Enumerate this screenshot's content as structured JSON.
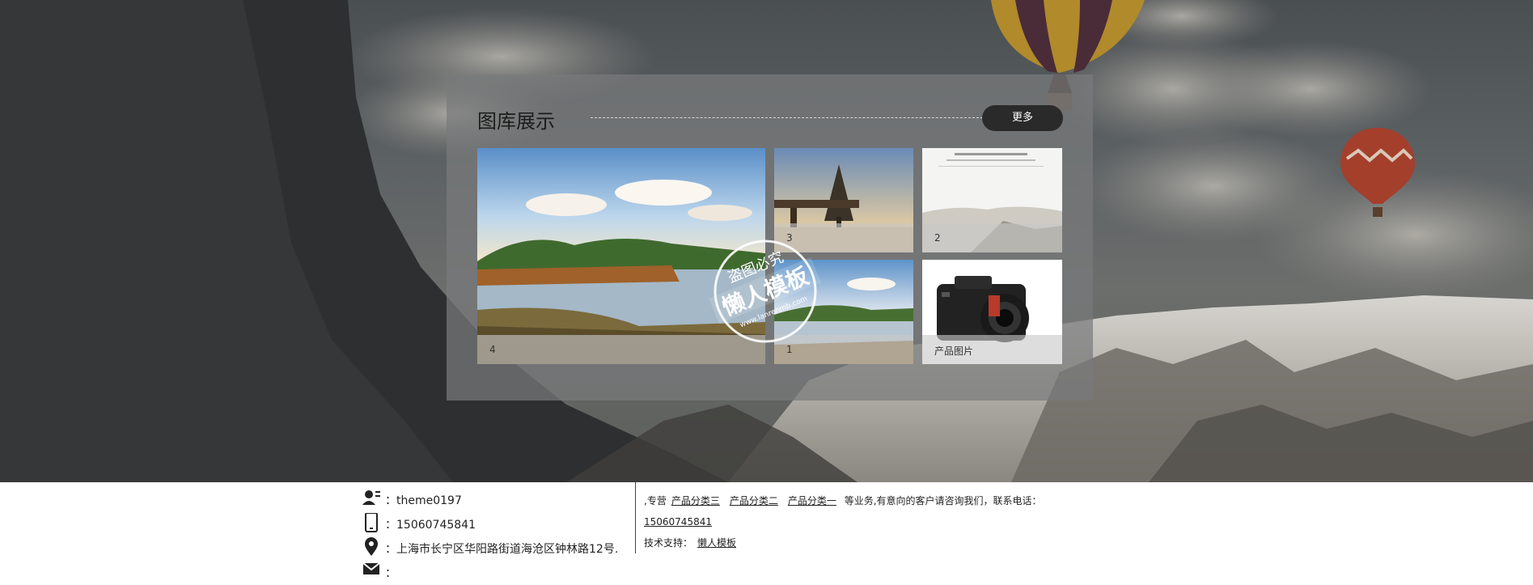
{
  "gallery": {
    "title": "图库展示",
    "more_label": "更多",
    "tiles": [
      {
        "caption": "4"
      },
      {
        "caption": "3"
      },
      {
        "caption": "2"
      },
      {
        "caption": "1"
      },
      {
        "caption": "产品图片"
      }
    ]
  },
  "watermark": {
    "line1": "盗图必究",
    "line2": "懒人模板",
    "line3": "www.lanrenmb.com"
  },
  "footer": {
    "contacts": [
      {
        "icon": "user-icon",
        "text": "：theme0197"
      },
      {
        "icon": "phone-icon",
        "text": "：15060745841"
      },
      {
        "icon": "location-icon",
        "text": "：上海市长宁区华阳路街道海沧区钟林路12号."
      },
      {
        "icon": "mail-icon",
        "text": "："
      }
    ],
    "intro_prefix": ",专营",
    "categories": [
      "产品分类三",
      "产品分类二",
      "产品分类一"
    ],
    "intro_suffix": "等业务,有意向的客户请咨询我们，联系电话：",
    "phone": "15060745841",
    "support_label": "技术支持：",
    "support_link": "懒人模板"
  }
}
